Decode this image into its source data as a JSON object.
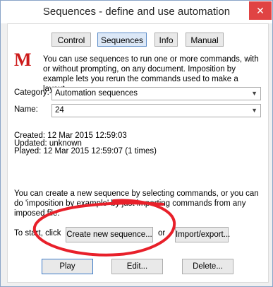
{
  "window": {
    "title": "Sequences - define and use automation",
    "close_glyph": "✕"
  },
  "tabs": [
    {
      "label": "Control"
    },
    {
      "label": "Sequences"
    },
    {
      "label": "Info"
    },
    {
      "label": "Manual"
    }
  ],
  "logo": {
    "letter": "M",
    "color": "#cc1a1a"
  },
  "intro": "You can use sequences to run one or more commands, with or without prompting, on any document. Imposition by example lets you rerun the commands used to make a layout.",
  "category": {
    "label": "Category:",
    "value": "Automation sequences"
  },
  "name": {
    "label": "Name:",
    "value": "24"
  },
  "info": {
    "created": "Created: 12 Mar 2015 12:59:03",
    "updated": "Updated: unknown",
    "played": "Played: 12 Mar 2015 12:59:07 (1 times)"
  },
  "hint": "You can create a new sequence by selecting commands, or you can do 'imposition by example' by just importing commands from any imposed file.",
  "start": {
    "prefix": "To start, click",
    "create_label": "Create new sequence...",
    "or": "or",
    "import_label": "Import/export..."
  },
  "bottom": {
    "play": "Play",
    "edit": "Edit...",
    "delete": "Delete..."
  },
  "annotation_color": "#e8202a"
}
